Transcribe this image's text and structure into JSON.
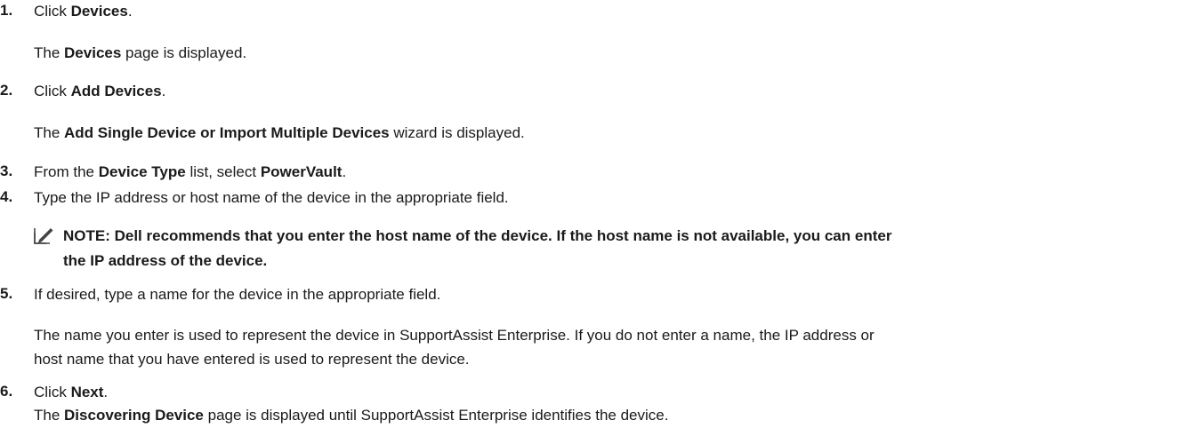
{
  "steps": [
    {
      "number": "1.",
      "action": [
        {
          "text": "Click ",
          "bold": false
        },
        {
          "text": "Devices",
          "bold": true
        },
        {
          "text": ".",
          "bold": false
        }
      ],
      "result": [
        {
          "text": "The ",
          "bold": false
        },
        {
          "text": "Devices",
          "bold": true
        },
        {
          "text": " page is displayed.",
          "bold": false
        }
      ]
    },
    {
      "number": "2.",
      "action": [
        {
          "text": "Click ",
          "bold": false
        },
        {
          "text": "Add Devices",
          "bold": true
        },
        {
          "text": ".",
          "bold": false
        }
      ],
      "result": [
        {
          "text": "The ",
          "bold": false
        },
        {
          "text": "Add Single Device or Import Multiple Devices",
          "bold": true
        },
        {
          "text": " wizard is displayed.",
          "bold": false
        }
      ]
    },
    {
      "number": "3.",
      "action": [
        {
          "text": "From the ",
          "bold": false
        },
        {
          "text": "Device Type",
          "bold": true
        },
        {
          "text": " list, select ",
          "bold": false
        },
        {
          "text": "PowerVault",
          "bold": true
        },
        {
          "text": ".",
          "bold": false
        }
      ]
    },
    {
      "number": "4.",
      "action": [
        {
          "text": "Type the IP address or host name of the device in the appropriate field.",
          "bold": false
        }
      ]
    },
    {
      "number": "5.",
      "action": [
        {
          "text": "If desired, type a name for the device in the appropriate field.",
          "bold": false
        }
      ],
      "result_lines": [
        "The name you enter is used to represent the device in SupportAssist Enterprise. If you do not enter a name, the IP address or",
        "host name that you have entered is used to represent the device."
      ]
    },
    {
      "number": "6.",
      "action": [
        {
          "text": "Click ",
          "bold": false
        },
        {
          "text": "Next",
          "bold": true
        },
        {
          "text": ".",
          "bold": false
        }
      ],
      "result": [
        {
          "text": "The ",
          "bold": false
        },
        {
          "text": "Discovering Device",
          "bold": true
        },
        {
          "text": " page is displayed until SupportAssist Enterprise identifies the device.",
          "bold": false
        }
      ]
    }
  ],
  "note": {
    "icon": "pencil-note-icon",
    "line1": "NOTE: Dell recommends that you enter the host name of the device. If the host name is not available, you can enter",
    "line2": "the IP address of the device."
  }
}
